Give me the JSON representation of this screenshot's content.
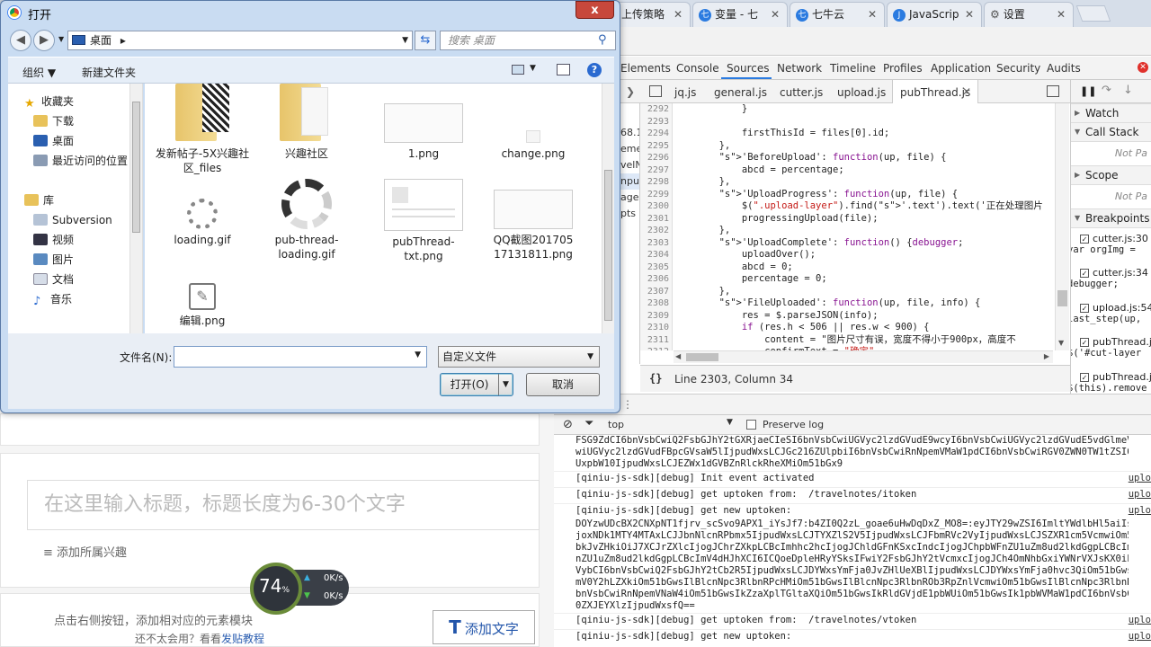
{
  "browser": {
    "tabs": [
      {
        "label": "上传策略",
        "icon": ""
      },
      {
        "label": "变量 - 七",
        "icon": "七"
      },
      {
        "label": "七牛云",
        "icon": "七"
      },
      {
        "label": "JavaScrip",
        "icon": "J"
      },
      {
        "label": "设置",
        "icon": "⚙"
      }
    ]
  },
  "devtools": {
    "tabs": [
      "Elements",
      "Console",
      "Sources",
      "Network",
      "Timeline",
      "Profiles",
      "Application",
      "Security",
      "Audits"
    ],
    "active_tab": "Sources",
    "files": [
      "jq.js",
      "general.js",
      "cutter.js",
      "upload.js",
      "pubThread.js"
    ],
    "active_file": "pubThread.js",
    "left_fragments": [
      "68.1",
      "emes",
      "velN",
      "nput",
      "ages",
      "pts"
    ],
    "line_numbers": [
      "2292",
      "2293",
      "2294",
      "2295",
      "2296",
      "2297",
      "2298",
      "2299",
      "2300",
      "2301",
      "2302",
      "2303",
      "2304",
      "2305",
      "2306",
      "2307",
      "2308",
      "2309",
      "2310",
      "2311",
      "2312"
    ],
    "code": [
      "            }",
      "",
      "            firstThisId = files[0].id;",
      "        },",
      "        'BeforeUpload': function(up, file) {",
      "            abcd = percentage;",
      "        },",
      "        'UploadProgress': function(up, file) {",
      "            $(\".upload-layer\").find('.text').text('正在处理图片",
      "            progressingUpload(file);",
      "        },",
      "        'UploadComplete': function() {debugger;",
      "            uploadOver();",
      "            abcd = 0;",
      "            percentage = 0;",
      "        },",
      "        'FileUploaded': function(up, file, info) {",
      "            res = $.parseJSON(info);",
      "            if (res.h < 506 || res.w < 900) {",
      "                content = \"图片尺寸有误，宽度不得小于900px，高度不",
      "                confirmText = \"确定\""
    ],
    "status": "Line 2303, Column 34",
    "status_icon": "{}",
    "right": {
      "watch": "Watch",
      "call_stack": "Call Stack",
      "not_paused": "Not Pa",
      "scope": "Scope",
      "breakpoints": "Breakpoints",
      "bp_items": [
        {
          "file": "cutter.js:30",
          "code": "var orgImg = "
        },
        {
          "file": "cutter.js:34",
          "code": "debugger;"
        },
        {
          "file": "upload.js:54",
          "code": "last_step(up,"
        },
        {
          "file": "pubThread.js",
          "code": "$('#cut-layer"
        },
        {
          "file": "pubThread.js",
          "code": "$(this).remove"
        }
      ]
    },
    "console": {
      "context": "top",
      "preserve_log": "Preserve log",
      "lines": [
        {
          "text": "FSG9ZdCI6bnVsbCwiQ2FsbGJhY2tGXRjaeCIeSI6bnVsbCwiUGVyc2lzdGVudE9wcyI6bnVsbCwiUGVyc2lzdGVudE5vdGlmeVVy",
          "link": ""
        },
        {
          "text": "wiUGVyc2lzdGVudFBpcGVsaW5lIjpudWxsLCJGc216ZUlpbiI6bnVsbCwiRnNpemVMaW1pdCI6bnVsbCwiRGV0ZWN0TW1tZSI6bnVs",
          "link": ""
        },
        {
          "text": "UxpbW10IjpudWxsLCJEZWx1dGVBZnRlckRheXMiOm51bGx9",
          "link": ""
        },
        {
          "text": "[qiniu-js-sdk][debug] Init event activated",
          "link": "uplo"
        },
        {
          "text": "[qiniu-js-sdk][debug] get uptoken from:  /travelnotes/itoken",
          "link": "uplo"
        },
        {
          "text": "[qiniu-js-sdk][debug] get new uptoken:",
          "link": "uplo"
        },
        {
          "text": "DOYzwUDcBX2CNXpNT1fjrv_scSvo9APX1_iYsJf7:b4ZI0Q2zL_goae6uHwDqDxZ_MO8=:eyJTY29wZSI6ImltYWdlbHl5aiIsIkR",
          "link": ""
        },
        {
          "text": "joxNDk1MTY4MTAxLCJJbnNlcnRPbmx5IjpudWxsLCJTYXZlS2V5IjpudWxsLCJFbmRVc2VyIjpudWxsLCJSZXR1cm5VcmwiOm51bGw",
          "link": ""
        },
        {
          "text": "bkJvZHkiOiJ7XCJrZXlcIjogJChrZXkpLCBcImhhc2hcIjogJChldGFnKSxcIndcIjogJChpbWFnZU1uZm8ud2lkdGgpLCBcImhcIj",
          "link": ""
        },
        {
          "text": "nZU1uZm8ud2lkdGgpLCBcImV4dHJhXCI6ICQoeDpleHRyYSksIFwiY2FsbGJhY2tVcmxcIjogJCh4OmNhbGxiYWNrVXJsKX0iLCJDY",
          "link": ""
        },
        {
          "text": "VybCI6bnVsbCwiQ2FsbGJhY2tCb2R5IjpudWxsLCJDYWxsYmFja0JvZHlUeXBlIjpudWxsLCJDYWxsYmFja0hvc3QiOm51bGwsIkN",
          "link": ""
        },
        {
          "text": "mV0Y2hLZXkiOm51bGwsIlBlcnNpc3RlbnRPcHMiOm51bGwsIlBlcnNpc3RlbnROb3RpZnlVcmwiOm51bGwsIlBlcnNpc3RlbnRQaX",
          "link": ""
        },
        {
          "text": "bnVsbCwiRnNpemVNaW4iOm51bGwsIkZzaXplTGltaXQiOm51bGwsIkRldGVjdE1pbWUiOm51bGwsIk1pbWVMaW1pdCI6bnVsbCwiR",
          "link": ""
        },
        {
          "text": "0ZXJEYXlzIjpudWxsfQ==",
          "link": ""
        },
        {
          "text": "[qiniu-js-sdk][debug] get uptoken from:  /travelnotes/vtoken",
          "link": "uplo"
        },
        {
          "text": "[qiniu-js-sdk][debug] get new uptoken:",
          "link": "uplo"
        }
      ]
    }
  },
  "dialog": {
    "title": "打开",
    "close": "x",
    "path": "桌面",
    "path_arrow": "▸",
    "search_placeholder": "搜索 桌面",
    "toolbar": {
      "organize": "组织 ▼",
      "new_folder": "新建文件夹"
    },
    "nav": {
      "favorites": "收藏夹",
      "fav_items": [
        "下载",
        "桌面",
        "最近访问的位置"
      ],
      "library": "库",
      "lib_items": [
        "Subversion",
        "视频",
        "图片",
        "文档",
        "音乐"
      ]
    },
    "files": [
      {
        "name": "发新帖子-5X兴趣社区_files",
        "kind": "folder"
      },
      {
        "name": "兴趣社区",
        "kind": "folder"
      },
      {
        "name": "1.png",
        "kind": "shot"
      },
      {
        "name": "change.png",
        "kind": "dot"
      },
      {
        "name": "loading.gif",
        "kind": "spinner"
      },
      {
        "name": "pub-thread-loading.gif",
        "kind": "spinner-big"
      },
      {
        "name": "pubThread-txt.png",
        "kind": "doc"
      },
      {
        "name": "QQ截图20170517131811.png",
        "kind": "shot"
      },
      {
        "name": "编辑.png",
        "kind": "edit"
      }
    ],
    "filename_label": "文件名(N):",
    "filename_value": "",
    "filetype": "自定义文件",
    "open_button": "打开(O)",
    "cancel_button": "取消"
  },
  "webpage": {
    "title_placeholder": "在这里输入标题，标题长度为6-30个文字",
    "add_interest": "≡ 添加所属兴趣",
    "hint_line1": "点击右侧按钮，添加相对应的元素模块",
    "hint_line2_prefix": "还不太会用？看看",
    "hint_line2_link": "发贴教程",
    "add_text_icon": "T",
    "add_text_button": "添加文字",
    "meter": {
      "percent": "74",
      "unit": "%",
      "up": "0K/s",
      "down": "0K/s"
    }
  },
  "colors": {
    "accent": "#2b7be0",
    "close_red": "#c7483c"
  }
}
